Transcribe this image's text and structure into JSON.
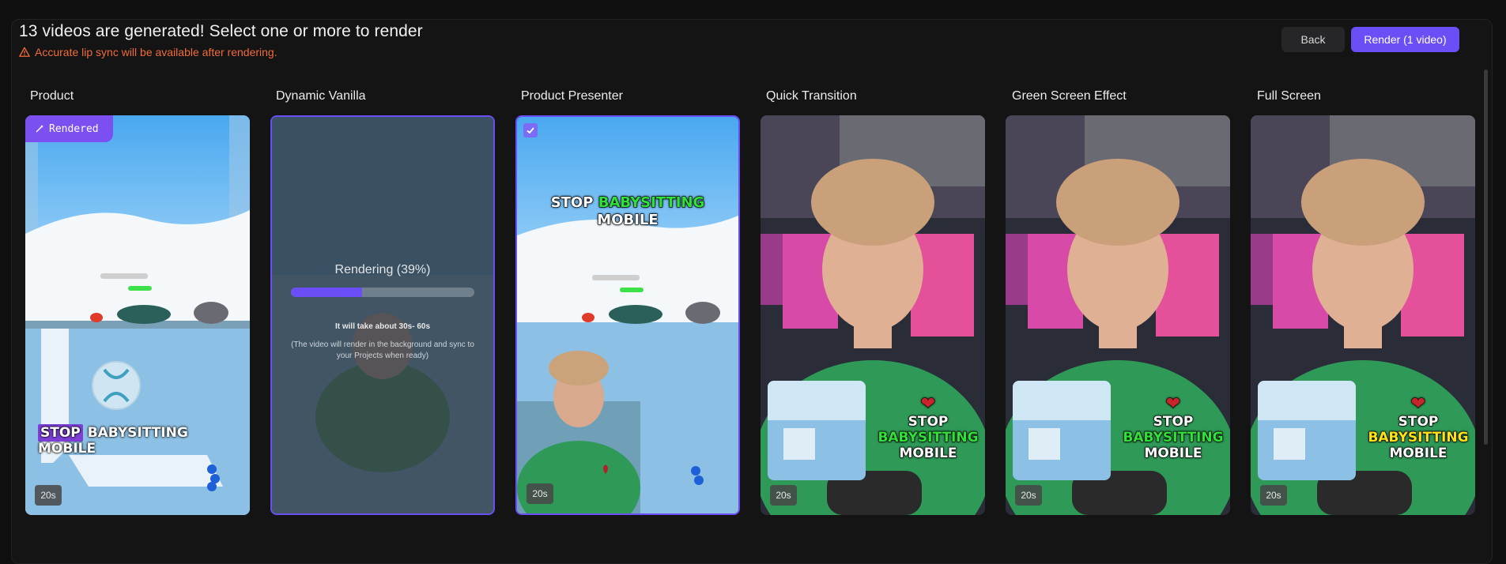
{
  "header": {
    "title": "13 videos are generated! Select one or more to render",
    "warning": "Accurate lip sync will be available after rendering."
  },
  "actions": {
    "back_label": "Back",
    "render_label": "Render (1 video)"
  },
  "columns": [
    {
      "label": "Product",
      "duration": "20s",
      "badge": "Rendered",
      "caption_a": "STOP",
      "caption_b": "BABYSITTING MOBILE"
    },
    {
      "label": "Dynamic Vanilla",
      "rendering_title": "Rendering (39%)",
      "progress": 0.39,
      "eta": "It will take about 30s- 60s",
      "note": "(The video will render in the background and sync to your Projects when ready)"
    },
    {
      "label": "Product Presenter",
      "duration": "20s",
      "caption_a": "STOP",
      "caption_b": "BABYSITTING",
      "caption_c": "MOBILE"
    },
    {
      "label": "Quick Transition",
      "duration": "20s",
      "caption_a": "STOP",
      "caption_b": "BABYSITTING",
      "caption_c": "MOBILE"
    },
    {
      "label": "Green Screen Effect",
      "duration": "20s",
      "caption_a": "STOP",
      "caption_b": "BABYSITTING",
      "caption_c": "MOBILE"
    },
    {
      "label": "Full Screen",
      "duration": "20s",
      "caption_a": "STOP",
      "caption_b": "BABYSITTING",
      "caption_c": "MOBILE"
    }
  ],
  "colors": {
    "accent": "#6b4ef5",
    "warning": "#f26b3a",
    "caption_green": "#31e03a",
    "caption_yellow": "#ffe21a"
  }
}
